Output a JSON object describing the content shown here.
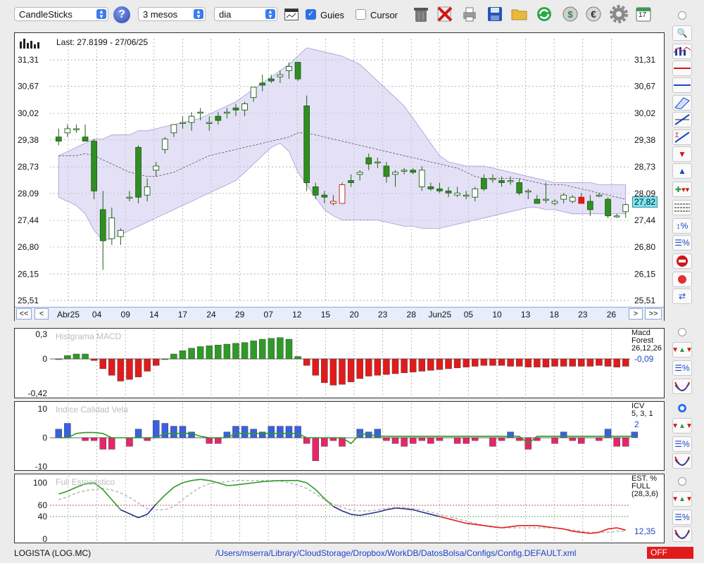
{
  "toolbar": {
    "chart_type": "CandleSticks",
    "period": "3 mesos",
    "interval": "dia",
    "guides_label": "Guies",
    "guides_checked": true,
    "cursor_label": "Cursor",
    "cursor_checked": false,
    "help_icon": "question-icon",
    "calendar_day": "17"
  },
  "main": {
    "last_label": "Last: 27.8199 - 27/06/25",
    "current_price_tag": "27,82",
    "nav": {
      "first": "<<",
      "prev": "<",
      "next": ">",
      "last": ">>"
    }
  },
  "macd": {
    "title": "Histgrama MACD",
    "name": "Macd Forest",
    "params": "26,12,26",
    "value": "-0,09"
  },
  "icv": {
    "title": "Indice Calidad Vela",
    "name": "ICV",
    "params": "5, 3, 1",
    "value": "2"
  },
  "stoch": {
    "title": "Full Estocastico",
    "name": "EST. % FULL",
    "params": "(28,3,6)",
    "value": "12,35"
  },
  "status": {
    "ticker": "LOGISTA (LOG.MC)",
    "config_path": "/Users/mserra/Library/CloudStorage/Dropbox/WorkDB/DatosBolsa/Configs/Config.DEFAULT.xml",
    "off_label": "OFF"
  },
  "chart_data": [
    {
      "type": "candlestick",
      "title": "",
      "y_ticks": [
        "31,31",
        "30,67",
        "30,02",
        "29,38",
        "28,73",
        "28,09",
        "27,44",
        "26,80",
        "26,15",
        "25,51"
      ],
      "ylim": [
        25.51,
        31.31
      ],
      "x_labels": [
        "Abr25",
        "04",
        "09",
        "14",
        "17",
        "24",
        "29",
        "07",
        "12",
        "15",
        "20",
        "23",
        "28",
        "Jun25",
        "05",
        "10",
        "13",
        "18",
        "23",
        "26"
      ],
      "candles": [
        [
          29.45,
          29.65,
          29.25,
          29.35
        ],
        [
          29.55,
          29.75,
          29.45,
          29.65
        ],
        [
          29.65,
          29.75,
          29.55,
          29.65
        ],
        [
          29.45,
          29.75,
          29.35,
          29.35
        ],
        [
          29.35,
          29.4,
          27.95,
          28.15
        ],
        [
          27.7,
          28.15,
          26.25,
          26.95
        ],
        [
          27.0,
          27.75,
          26.85,
          27.5
        ],
        [
          27.05,
          27.25,
          26.85,
          27.2
        ],
        [
          28.0,
          28.15,
          27.9,
          28.0
        ],
        [
          29.2,
          29.25,
          27.85,
          28.0
        ],
        [
          28.05,
          28.45,
          27.9,
          28.25
        ],
        [
          28.65,
          28.85,
          28.5,
          28.75
        ],
        [
          29.15,
          29.45,
          29.05,
          29.4
        ],
        [
          29.55,
          29.75,
          29.45,
          29.75
        ],
        [
          29.8,
          29.95,
          29.65,
          29.8
        ],
        [
          29.8,
          30.05,
          29.6,
          29.95
        ],
        [
          30.05,
          30.15,
          29.85,
          30.05
        ],
        [
          29.8,
          29.95,
          29.6,
          29.8
        ],
        [
          29.95,
          30.05,
          29.75,
          29.85
        ],
        [
          30.05,
          30.15,
          29.9,
          30.05
        ],
        [
          30.15,
          30.25,
          29.95,
          30.1
        ],
        [
          30.1,
          30.3,
          29.95,
          30.25
        ],
        [
          30.4,
          30.65,
          30.3,
          30.65
        ],
        [
          30.75,
          30.95,
          30.55,
          30.7
        ],
        [
          30.85,
          30.95,
          30.75,
          30.8
        ],
        [
          30.9,
          31.05,
          30.75,
          30.95
        ],
        [
          31.05,
          31.25,
          30.85,
          31.15
        ],
        [
          31.25,
          31.25,
          30.8,
          30.85
        ],
        [
          30.2,
          30.45,
          28.15,
          28.35
        ],
        [
          28.25,
          28.35,
          27.95,
          28.05
        ],
        [
          28.05,
          28.15,
          27.85,
          28.0
        ],
        [
          27.85,
          28.05,
          27.8,
          27.9
        ],
        [
          28.3,
          28.35,
          27.85,
          27.85
        ],
        [
          28.4,
          28.55,
          28.25,
          28.35
        ],
        [
          28.55,
          28.65,
          28.4,
          28.6
        ],
        [
          28.95,
          29.05,
          28.65,
          28.8
        ],
        [
          28.85,
          28.95,
          28.7,
          28.85
        ],
        [
          28.75,
          28.85,
          28.35,
          28.5
        ],
        [
          28.55,
          28.65,
          28.25,
          28.6
        ],
        [
          28.65,
          28.7,
          28.55,
          28.65
        ],
        [
          28.65,
          28.7,
          28.55,
          28.6
        ],
        [
          28.25,
          28.75,
          28.15,
          28.65
        ],
        [
          28.25,
          28.35,
          28.15,
          28.2
        ],
        [
          28.2,
          28.35,
          28.1,
          28.15
        ],
        [
          28.15,
          28.25,
          28.0,
          28.1
        ],
        [
          28.05,
          28.25,
          28.0,
          28.1
        ],
        [
          28.05,
          28.15,
          27.95,
          28.05
        ],
        [
          28.0,
          28.25,
          27.9,
          28.2
        ],
        [
          28.45,
          28.55,
          28.15,
          28.2
        ],
        [
          28.45,
          28.55,
          28.35,
          28.45
        ],
        [
          28.4,
          28.5,
          28.25,
          28.35
        ],
        [
          28.4,
          28.5,
          28.3,
          28.4
        ],
        [
          28.35,
          28.45,
          28.05,
          28.1
        ],
        [
          28.15,
          28.2,
          27.95,
          28.15
        ],
        [
          27.95,
          28.05,
          27.85,
          27.85
        ],
        [
          27.95,
          28.35,
          27.85,
          27.95
        ],
        [
          27.85,
          27.95,
          27.8,
          27.9
        ],
        [
          27.95,
          28.1,
          27.85,
          28.05
        ],
        [
          27.9,
          28.05,
          27.85,
          28.0
        ],
        [
          28.0,
          28.1,
          27.85,
          27.85
        ],
        [
          27.9,
          28.05,
          27.55,
          27.7
        ],
        [
          28.05,
          28.1,
          28.0,
          28.05
        ],
        [
          27.95,
          28.0,
          27.5,
          27.55
        ],
        [
          27.55,
          27.6,
          27.5,
          27.55
        ],
        [
          27.65,
          27.85,
          27.5,
          27.82
        ]
      ],
      "sma": [
        29.0,
        29.0,
        29.0,
        29.05,
        29.0,
        28.9,
        28.8,
        28.7,
        28.6,
        28.55,
        28.5,
        28.5,
        28.55,
        28.6,
        28.7,
        28.8,
        28.9,
        29.0,
        29.05,
        29.1,
        29.15,
        29.2,
        29.25,
        29.3,
        29.35,
        29.4,
        29.45,
        29.55,
        29.55,
        29.5,
        29.45,
        29.4,
        29.35,
        29.3,
        29.25,
        29.2,
        29.15,
        29.1,
        29.05,
        29.0,
        28.95,
        28.9,
        28.85,
        28.8,
        28.75,
        28.7,
        28.6,
        28.5,
        28.45,
        28.45,
        28.45,
        28.45,
        28.45,
        28.4,
        28.35,
        28.3,
        28.3,
        28.3,
        28.25,
        28.2,
        28.15,
        28.1,
        28.05,
        28.0,
        27.95
      ],
      "band_upper": [
        29.0,
        29.1,
        29.2,
        29.3,
        29.4,
        29.4,
        29.5,
        29.5,
        29.5,
        29.6,
        29.6,
        29.65,
        29.7,
        29.75,
        29.8,
        29.85,
        29.9,
        30.0,
        30.1,
        30.2,
        30.3,
        30.45,
        30.6,
        30.75,
        30.9,
        31.05,
        31.2,
        31.4,
        31.6,
        31.55,
        31.5,
        31.45,
        31.4,
        31.3,
        31.2,
        31.0,
        30.8,
        30.6,
        30.4,
        30.2,
        29.9,
        29.6,
        29.3,
        29.0,
        28.85,
        28.8,
        28.75,
        28.75,
        28.75,
        28.7,
        28.65,
        28.6,
        28.55,
        28.5,
        28.45,
        28.4,
        28.35,
        28.35,
        28.35,
        28.35,
        28.35,
        28.3,
        28.3,
        28.3,
        28.3
      ],
      "band_lower": [
        28.0,
        27.9,
        27.8,
        27.6,
        27.2,
        26.95,
        27.0,
        27.1,
        27.2,
        27.3,
        27.4,
        27.5,
        27.6,
        27.7,
        27.8,
        27.9,
        28.0,
        28.1,
        28.2,
        28.3,
        28.4,
        28.6,
        28.8,
        29.0,
        29.2,
        29.3,
        29.1,
        28.6,
        28.3,
        28.0,
        27.7,
        27.55,
        27.45,
        27.45,
        27.45,
        27.45,
        27.45,
        27.4,
        27.35,
        27.3,
        27.3,
        27.25,
        27.25,
        27.25,
        27.3,
        27.35,
        27.4,
        27.45,
        27.5,
        27.55,
        27.6,
        27.65,
        27.7,
        27.75,
        27.75,
        27.7,
        27.7,
        27.65,
        27.6,
        27.6,
        27.6,
        27.6,
        27.6,
        27.6,
        27.6
      ]
    },
    {
      "type": "bar",
      "title": "Histgrama MACD",
      "y_ticks": [
        "0,3",
        "0",
        "-0,42"
      ],
      "ylim": [
        -0.42,
        0.3
      ],
      "values": [
        0.0,
        0.04,
        0.06,
        0.06,
        -0.02,
        -0.12,
        -0.2,
        -0.27,
        -0.25,
        -0.22,
        -0.15,
        -0.08,
        0.0,
        0.06,
        0.1,
        0.13,
        0.15,
        0.16,
        0.17,
        0.18,
        0.19,
        0.2,
        0.22,
        0.24,
        0.25,
        0.26,
        0.24,
        0.03,
        -0.08,
        -0.2,
        -0.29,
        -0.32,
        -0.31,
        -0.28,
        -0.24,
        -0.21,
        -0.2,
        -0.19,
        -0.18,
        -0.17,
        -0.16,
        -0.15,
        -0.14,
        -0.13,
        -0.12,
        -0.11,
        -0.1,
        -0.09,
        -0.08,
        -0.08,
        -0.08,
        -0.09,
        -0.09,
        -0.1,
        -0.1,
        -0.1,
        -0.09,
        -0.09,
        -0.09,
        -0.09,
        -0.09,
        -0.08,
        -0.09,
        -0.1,
        -0.09
      ]
    },
    {
      "type": "bar",
      "title": "Indice Calidad Vela",
      "y_ticks": [
        "10",
        "0",
        "-10"
      ],
      "ylim": [
        -10,
        10
      ],
      "values": [
        3,
        5,
        0,
        -1,
        -1,
        -4,
        -4,
        0,
        -3,
        3,
        -1,
        6,
        5,
        4,
        4,
        2,
        0,
        -2,
        -2,
        2,
        4,
        4,
        3,
        2,
        4,
        4,
        4,
        4,
        -2,
        -8,
        -3,
        -1,
        -3,
        0,
        3,
        2,
        3,
        -1,
        -2,
        -3,
        -2,
        -1,
        -2,
        -1,
        0,
        -2,
        -2,
        -1,
        0,
        -3,
        -1,
        2,
        -1,
        -4,
        -1,
        0,
        -2,
        2,
        -1,
        -2,
        0,
        -1,
        3,
        -3,
        -3,
        2
      ],
      "line": [
        0,
        0,
        1.5,
        1.8,
        1.8,
        1.5,
        0,
        0,
        0,
        0,
        0,
        0,
        1.5,
        1.5,
        1.5,
        1.5,
        0.5,
        0,
        0,
        0,
        1.5,
        1.5,
        1.5,
        1.5,
        1.5,
        1.5,
        1.5,
        1.5,
        0,
        0,
        0,
        0,
        0,
        -2,
        1.2,
        1.2,
        0.5,
        0.5,
        0.5,
        0.5,
        0.5,
        0.5,
        0.5,
        0.5,
        0.5,
        0.5,
        0.5,
        0.5,
        0.5,
        0.5,
        0.5,
        0.5,
        0.5,
        -2,
        0.5,
        0.5,
        0.5,
        0.5,
        0.5,
        0.5,
        0.5,
        0.5,
        0.5,
        0.5,
        0.5,
        0.5
      ]
    },
    {
      "type": "line",
      "title": "Full Estocastico",
      "y_ticks": [
        "100",
        "60",
        "40",
        "0"
      ],
      "ylim": [
        0,
        100
      ],
      "reference_lines": [
        60,
        40
      ],
      "k_line": [
        80,
        85,
        92,
        98,
        100,
        88,
        70,
        52,
        45,
        38,
        44,
        62,
        78,
        92,
        100,
        104,
        106,
        104,
        100,
        95,
        96,
        98,
        100,
        102,
        103,
        104,
        104,
        104,
        100,
        88,
        72,
        58,
        50,
        44,
        42,
        45,
        48,
        52,
        55,
        54,
        52,
        48,
        44,
        40,
        36,
        32,
        28,
        26,
        24,
        22,
        20,
        22,
        24,
        24,
        24,
        22,
        20,
        18,
        14,
        12,
        10,
        12,
        18,
        20,
        16
      ],
      "d_line": [
        70,
        75,
        82,
        86,
        88,
        90,
        87,
        82,
        74,
        64,
        54,
        52,
        52,
        58,
        70,
        82,
        92,
        98,
        100,
        102,
        104,
        104,
        104,
        104,
        104,
        103,
        100,
        96,
        90,
        80,
        70,
        62,
        56,
        52,
        50,
        50,
        52,
        54,
        56,
        56,
        54,
        52,
        48,
        44,
        40,
        36,
        32,
        28,
        24,
        21,
        20,
        20,
        20,
        20,
        20,
        20,
        20,
        18,
        16,
        14,
        12,
        12,
        12,
        14,
        14
      ]
    }
  ]
}
